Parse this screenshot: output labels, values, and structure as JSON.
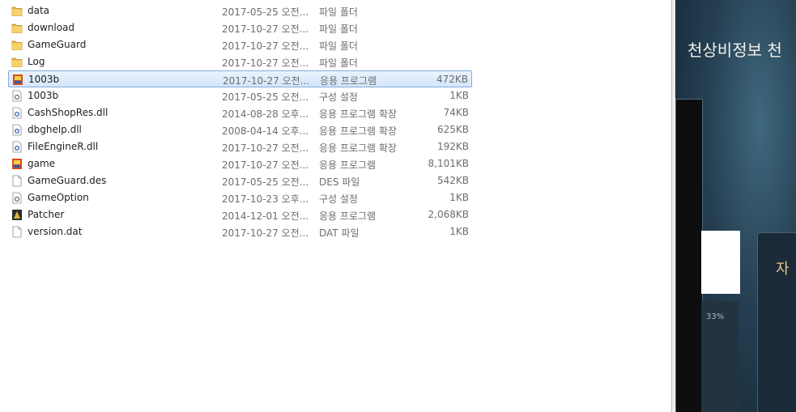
{
  "files": [
    {
      "name": "data",
      "date": "2017-05-25 오전...",
      "type": "파일 폴더",
      "size": "",
      "icon": "folder-icon"
    },
    {
      "name": "download",
      "date": "2017-10-27 오전...",
      "type": "파일 폴더",
      "size": "",
      "icon": "folder-icon"
    },
    {
      "name": "GameGuard",
      "date": "2017-10-27 오전...",
      "type": "파일 폴더",
      "size": "",
      "icon": "folder-icon"
    },
    {
      "name": "Log",
      "date": "2017-10-27 오전...",
      "type": "파일 폴더",
      "size": "",
      "icon": "folder-icon"
    },
    {
      "name": "1003b",
      "date": "2017-10-27 오전...",
      "type": "응용 프로그램",
      "size": "472KB",
      "icon": "app-icon"
    },
    {
      "name": "1003b",
      "date": "2017-05-25 오전...",
      "type": "구성 설정",
      "size": "1KB",
      "icon": "config-icon"
    },
    {
      "name": "CashShopRes.dll",
      "date": "2014-08-28 오후...",
      "type": "응용 프로그램 확장",
      "size": "74KB",
      "icon": "dll-icon"
    },
    {
      "name": "dbghelp.dll",
      "date": "2008-04-14 오후...",
      "type": "응용 프로그램 확장",
      "size": "625KB",
      "icon": "dll-icon"
    },
    {
      "name": "FileEngineR.dll",
      "date": "2017-10-27 오전...",
      "type": "응용 프로그램 확장",
      "size": "192KB",
      "icon": "dll-icon"
    },
    {
      "name": "game",
      "date": "2017-10-27 오전...",
      "type": "응용 프로그램",
      "size": "8,101KB",
      "icon": "app-icon"
    },
    {
      "name": "GameGuard.des",
      "date": "2017-05-25 오전...",
      "type": "DES 파일",
      "size": "542KB",
      "icon": "file-icon"
    },
    {
      "name": "GameOption",
      "date": "2017-10-23 오후...",
      "type": "구성 설정",
      "size": "1KB",
      "icon": "config-icon"
    },
    {
      "name": "Patcher",
      "date": "2014-12-01 오전...",
      "type": "응용 프로그램",
      "size": "2,068KB",
      "icon": "patcher-icon"
    },
    {
      "name": "version.dat",
      "date": "2017-10-27 오전...",
      "type": "DAT 파일",
      "size": "1KB",
      "icon": "file-icon"
    }
  ],
  "game_window": {
    "title": "천상비정보 천",
    "panel_label": "자",
    "progress_text": "33%"
  },
  "colors": {
    "selection": "#cce3fb",
    "folder": "#e8b93e",
    "game_bg": "#253f52"
  }
}
